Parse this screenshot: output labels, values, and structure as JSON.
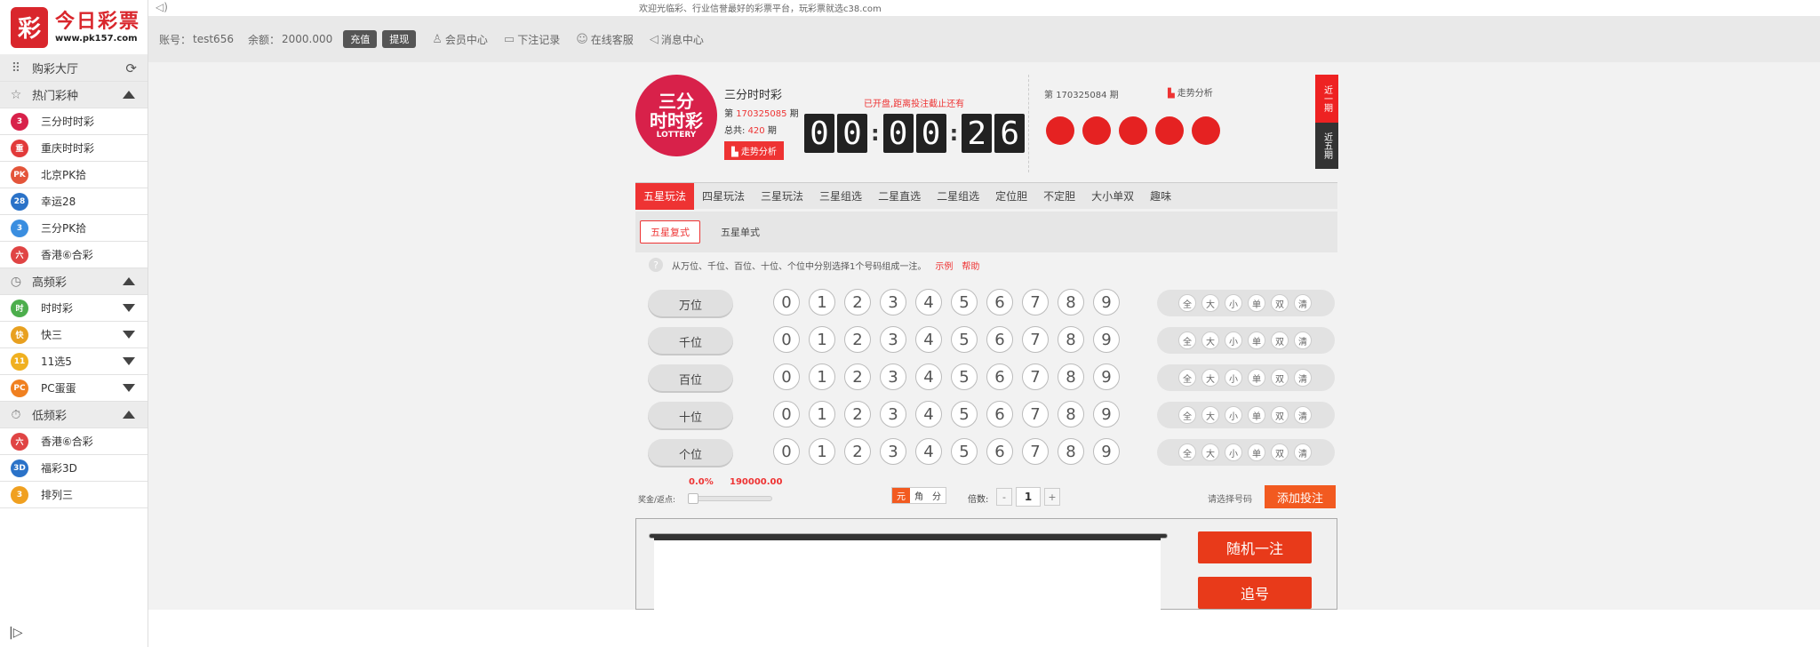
{
  "sidebar": {
    "logo": {
      "mark": "彩",
      "title": "今日彩票",
      "url": "www.pk157.com"
    },
    "lobby": {
      "label": "购彩大厅",
      "icon": "grid-icon"
    },
    "groups": [
      {
        "label": "热门彩种",
        "icon": "star-icon",
        "expanded": true,
        "items": [
          {
            "label": "三分时时彩",
            "color": "#d8214a",
            "badge": "3"
          },
          {
            "label": "重庆时时彩",
            "color": "#e23a3a",
            "badge": "重"
          },
          {
            "label": "北京PK拾",
            "color": "#e4553a",
            "badge": "PK"
          },
          {
            "label": "幸运28",
            "color": "#2a72c8",
            "badge": "28"
          },
          {
            "label": "三分PK拾",
            "color": "#3a8ee0",
            "badge": "3"
          },
          {
            "label": "香港⑥合彩",
            "color": "#e04444",
            "badge": "六"
          }
        ]
      },
      {
        "label": "高频彩",
        "icon": "clock-icon",
        "expanded": true,
        "items": [
          {
            "label": "时时彩",
            "color": "#4cae4c",
            "badge": "时",
            "has_sub": true
          },
          {
            "label": "快三",
            "color": "#e8a020",
            "badge": "快",
            "has_sub": true
          },
          {
            "label": "11选5",
            "color": "#f0b020",
            "badge": "11",
            "has_sub": true
          },
          {
            "label": "PC蛋蛋",
            "color": "#f08020",
            "badge": "PC",
            "has_sub": true
          }
        ]
      },
      {
        "label": "低频彩",
        "icon": "stopwatch-icon",
        "expanded": true,
        "items": [
          {
            "label": "香港⑥合彩",
            "color": "#e04444",
            "badge": "六"
          },
          {
            "label": "福彩3D",
            "color": "#2a72c8",
            "badge": "3D"
          },
          {
            "label": "排列三",
            "color": "#f0a020",
            "badge": "3"
          }
        ]
      }
    ]
  },
  "topbar": {
    "welcome": "欢迎光临彩、行业信誉最好的彩票平台，玩彩票就选c38.com"
  },
  "account": {
    "user_label": "账号：",
    "user": "test656",
    "balance_label": "余额：",
    "balance": "2000.000",
    "deposit": "充值",
    "withdraw": "提现",
    "links": [
      {
        "label": "会员中心",
        "icon": "user-icon"
      },
      {
        "label": "下注记录",
        "icon": "book-icon"
      },
      {
        "label": "在线客服",
        "icon": "chat-icon"
      },
      {
        "label": "消息中心",
        "icon": "speaker-icon"
      }
    ]
  },
  "game": {
    "badge_main": "三分\n时时彩",
    "badge_sub": "LOTTERY",
    "name": "三分时时彩",
    "issue_prefix": "第",
    "issue": "170325085",
    "issue_suffix": "期",
    "total_prefix": "总共:",
    "total": "420",
    "total_suffix": "期",
    "trend": "走势分析",
    "status": "已开盘,距离投注截止还有",
    "countdown": [
      "0",
      "0",
      "0",
      "0",
      "2",
      "6"
    ],
    "prev_issue_prefix": "第",
    "prev_issue": "170325084",
    "prev_issue_suffix": "期",
    "prev_trend": "走势分析",
    "ball_color": "#e52222",
    "side_tabs": [
      "近一期",
      "近五期"
    ]
  },
  "tabs": [
    "五星玩法",
    "四星玩法",
    "三星玩法",
    "三星组选",
    "二星直选",
    "二星组选",
    "定位胆",
    "不定胆",
    "大小单双",
    "趣味"
  ],
  "subtabs": [
    "五星复式",
    "五星单式"
  ],
  "hint": {
    "text": "从万位、千位、百位、十位、个位中分别选择1个号码组成一注。",
    "example": "示例",
    "help": "帮助"
  },
  "positions": [
    "万位",
    "千位",
    "百位",
    "十位",
    "个位"
  ],
  "digits": [
    "0",
    "1",
    "2",
    "3",
    "4",
    "5",
    "6",
    "7",
    "8",
    "9"
  ],
  "quick": [
    "全",
    "大",
    "小",
    "单",
    "双",
    "清"
  ],
  "bet": {
    "rebate_pct": "0.0%",
    "prize": "190000.00",
    "rebate_label": "奖金/返点:",
    "units": [
      "元",
      "角",
      "分"
    ],
    "multiplier_label": "倍数:",
    "multiplier": "1",
    "minus": "-",
    "plus": "+",
    "select_hint": "请选择号码",
    "add": "添加投注",
    "random": "随机一注",
    "chase": "追号"
  }
}
